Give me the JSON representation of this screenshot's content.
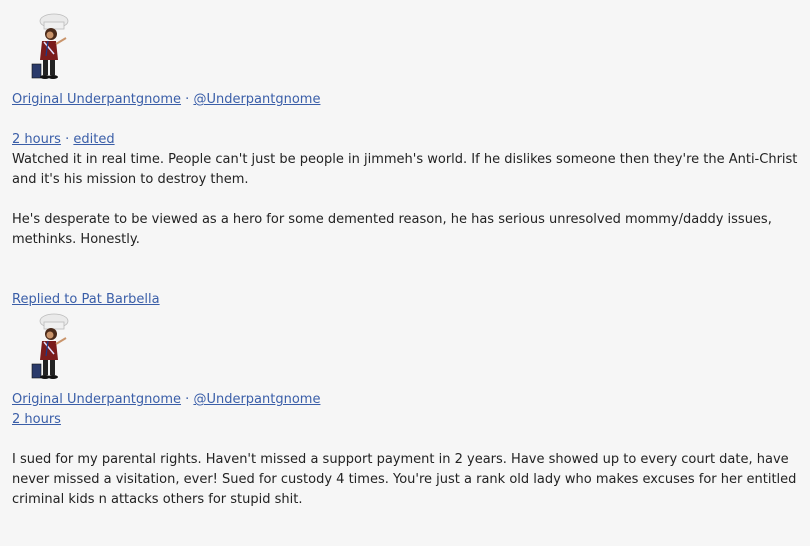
{
  "comments": [
    {
      "avatar_icon": "gnome-chef-avatar",
      "display_name": "Original Underpantgnome",
      "separator": "·",
      "handle": "@Underpantgnome",
      "time": "2 hours",
      "edited": "edited",
      "paragraphs": [
        "Watched it in real time. People can't just be people in jimmeh's world. If he dislikes someone then they're the Anti-Christ and it's his mission to destroy them.",
        "He's desperate to be viewed as a hero for some demented reason, he has serious unresolved mommy/daddy issues, methinks. Honestly."
      ]
    },
    {
      "replied_to": "Replied to Pat Barbella",
      "avatar_icon": "gnome-chef-avatar",
      "display_name": "Original Underpantgnome",
      "separator": "·",
      "handle": "@Underpantgnome",
      "time": "2 hours",
      "paragraphs": [
        "I sued for my parental rights. Haven't missed a support payment in 2 years. Have showed up to every court date, have never missed a visitation, ever! Sued for custody 4 times. You're just a rank old lady who makes excuses for her entitled criminal kids n attacks others for stupid shit."
      ]
    }
  ]
}
